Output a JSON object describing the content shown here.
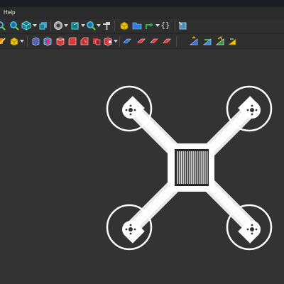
{
  "window": {
    "menubar": {
      "help_label": "Help"
    }
  },
  "toolbar_main": {
    "code_label": "{}",
    "icons": [
      "zoom-fit-icon",
      "zoom-selection-icon",
      "view-cube-icon",
      "view-axo-icon",
      "draw-style-icon",
      "bounding-box-icon",
      "zoom-dropdown-icon",
      "measure-icon",
      "part-icon",
      "folder-icon",
      "link-icon",
      "macro-icon"
    ]
  },
  "toolbar_part": {
    "icons": [
      "sketch-icon",
      "primitive-cube-icon",
      "pad-icon",
      "pocket-icon",
      "revolve-icon",
      "fillet-icon",
      "chamfer-icon",
      "boolean-icon",
      "mirror-icon",
      "pattern-icon",
      "thickness-icon",
      "draft-icon",
      "measure-linear-icon",
      "measure-angle-icon",
      "measure-clear-icon",
      "measure-toggle-icon"
    ]
  },
  "viewport": {
    "model": "quadcopter-frame",
    "background": "#333333",
    "part_color": "#f2f2f2",
    "outline_color": "#ffffff"
  }
}
